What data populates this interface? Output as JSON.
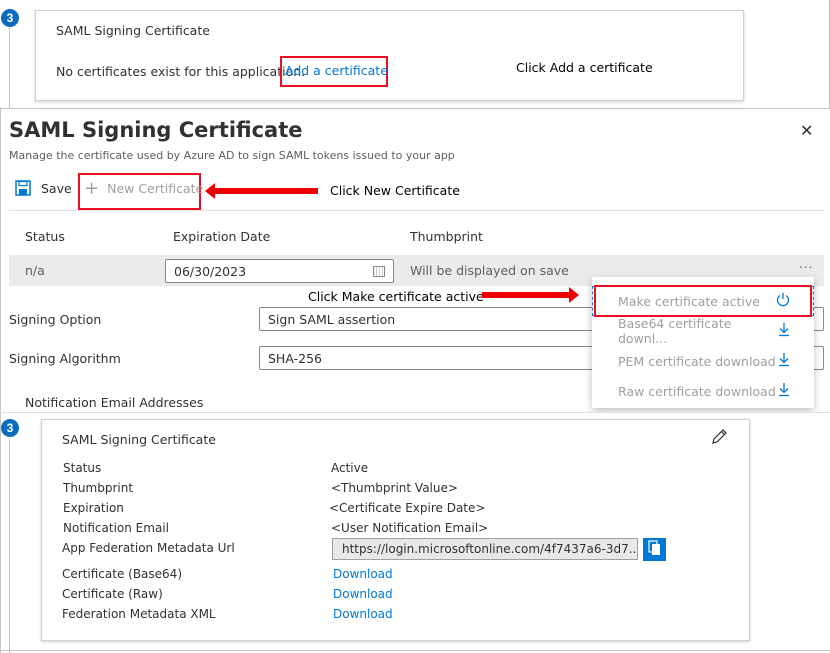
{
  "step_badge": "3",
  "top_card": {
    "title": "SAML Signing Certificate",
    "empty_message": "No certificates exist for this application.",
    "add_link": "Add a certificate",
    "annotation": "Click Add a certificate"
  },
  "panel": {
    "title": "SAML Signing Certificate",
    "subtitle": "Manage the certificate used by Azure AD to sign SAML tokens issued to your app",
    "toolbar": {
      "save_label": "Save",
      "new_cert_label": "New Certificate",
      "annotation": "Click New Certificate"
    },
    "table": {
      "headers": [
        "Status",
        "Expiration Date",
        "Thumbprint"
      ],
      "row": {
        "status": "n/a",
        "expiration": "06/30/2023",
        "thumbprint": "Will be displayed on save",
        "more": "..."
      }
    },
    "annotation_active": "Click Make certificate active",
    "context_menu": [
      {
        "label": "Make certificate active",
        "icon": "power-icon"
      },
      {
        "label": "Base64 certificate downl...",
        "icon": "download-icon"
      },
      {
        "label": "PEM certificate download",
        "icon": "download-icon"
      },
      {
        "label": "Raw certificate download",
        "icon": "download-icon"
      }
    ],
    "signing_option": {
      "label": "Signing Option",
      "value": "Sign SAML assertion"
    },
    "signing_algorithm": {
      "label": "Signing Algorithm",
      "value": "SHA-256"
    },
    "notification_label": "Notification Email Addresses",
    "close_glyph": "✕"
  },
  "bottom_card": {
    "title": "SAML Signing Certificate",
    "rows": [
      {
        "label": "Status",
        "value": "Active"
      },
      {
        "label": "Thumbprint",
        "value": "<Thumbprint Value>"
      },
      {
        "label": "Expiration",
        "value": "<Certificate Expire Date>"
      },
      {
        "label": "Notification Email",
        "value": "<User Notification Email>"
      }
    ],
    "metadata_url_label": "App Federation Metadata Url",
    "metadata_url_value": "https://login.microsoftonline.com/4f7437a6-3d7...",
    "downloads": [
      {
        "label": "Certificate (Base64)",
        "link": "Download"
      },
      {
        "label": "Certificate (Raw)",
        "link": "Download"
      },
      {
        "label": "Federation Metadata XML",
        "link": "Download"
      }
    ]
  },
  "colors": {
    "accent": "#0078d4",
    "highlight": "#e81123",
    "badge": "#0b6cbd"
  }
}
